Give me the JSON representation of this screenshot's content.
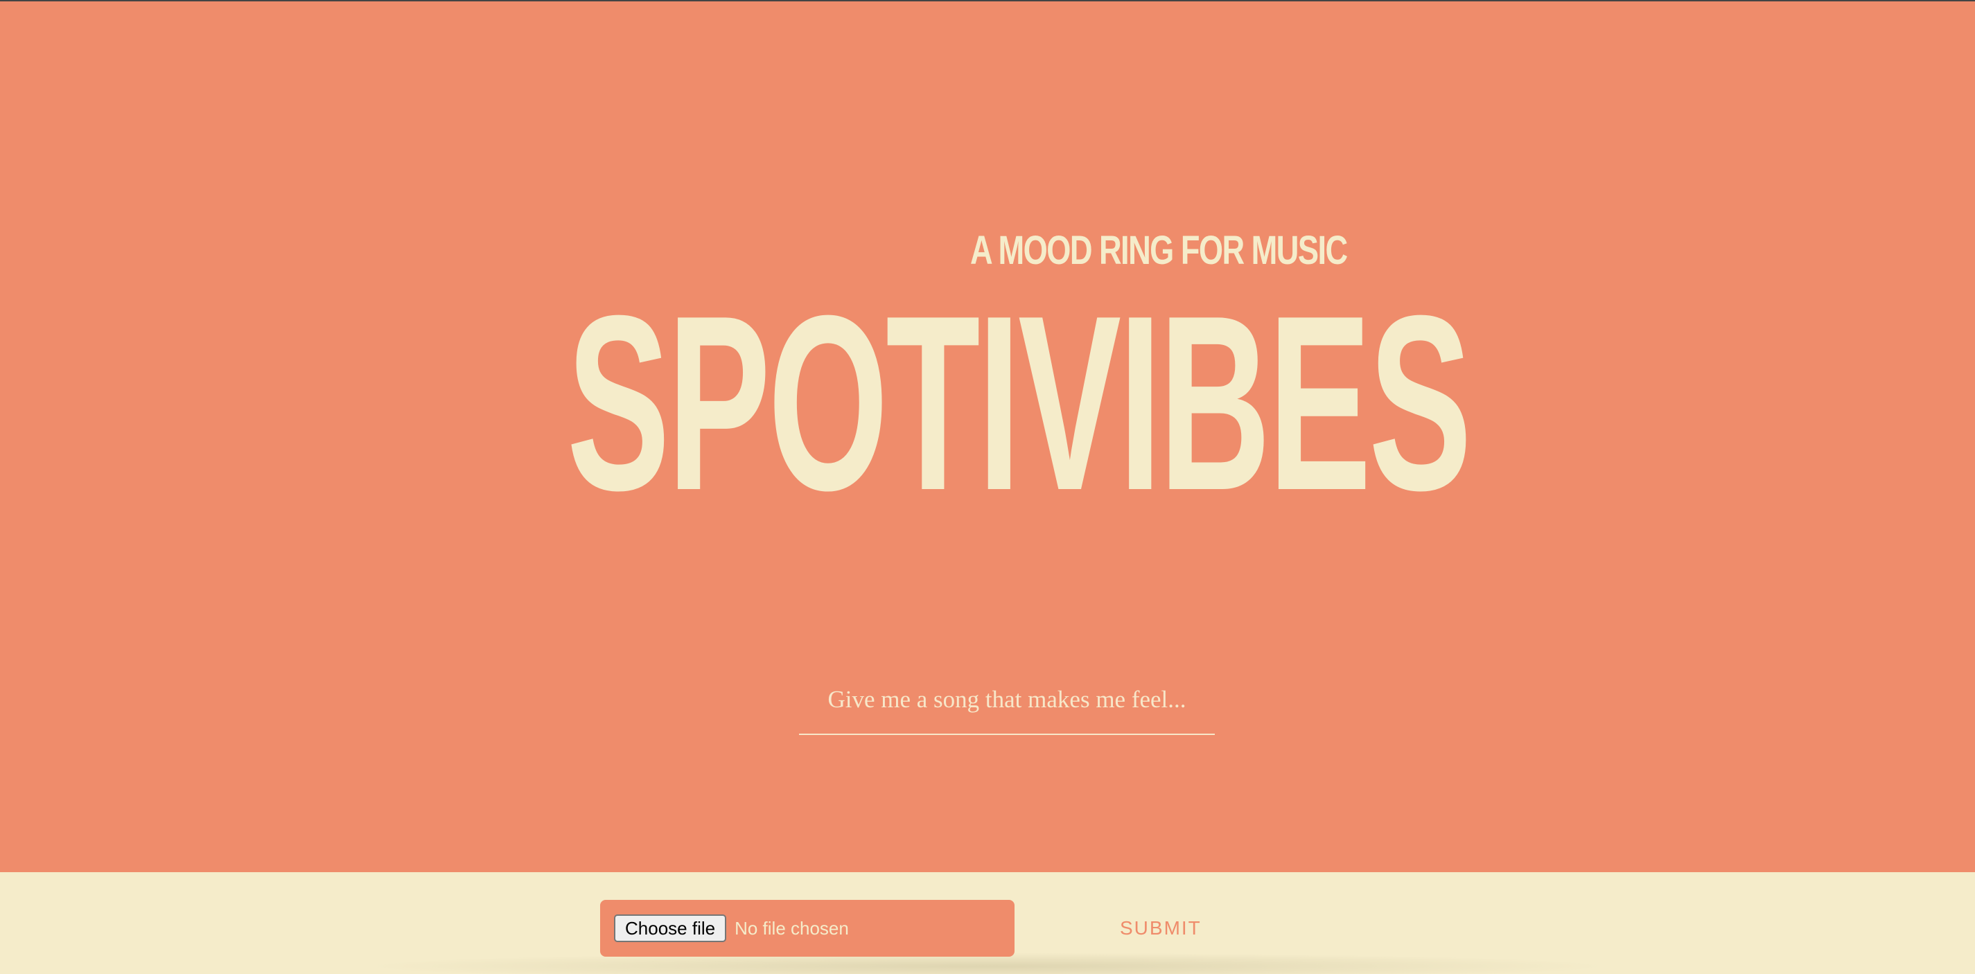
{
  "hero": {
    "tagline": "A MOOD RING FOR MUSIC",
    "title": "SPOTIVIBES",
    "mood_input": {
      "placeholder": "Give me a song that makes me feel...",
      "value": ""
    }
  },
  "footer": {
    "choose_file_label": "Choose file",
    "file_status": "No file chosen",
    "submit_label": "SUBMIT"
  },
  "colors": {
    "hero_background": "#ef8c6b",
    "cream": "#f5ecca",
    "accent": "#ef8c6b"
  }
}
